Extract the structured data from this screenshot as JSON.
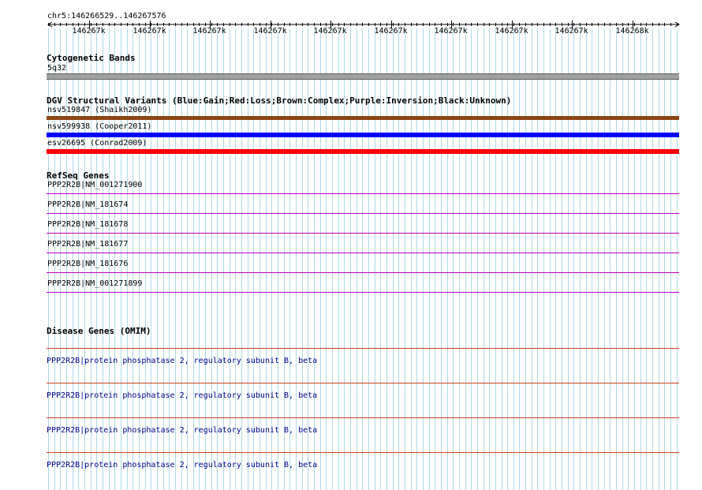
{
  "location": "chr5:146266529..146267576",
  "ruler": {
    "ticks": [
      "146267k",
      "146267k",
      "146267k",
      "146267k",
      "146267k",
      "146267k",
      "146267k",
      "146267k",
      "146267k",
      "146268k"
    ]
  },
  "tracks": {
    "cytoband": {
      "title": "Cytogenetic Bands",
      "label": "5q32",
      "color": "#a0a0a0"
    },
    "dgv": {
      "title": "DGV Structural Variants (Blue:Gain;Red:Loss;Brown:Complex;Purple:Inversion;Black:Unknown)",
      "items": [
        {
          "label": "nsv519847 (Shaikh2009)",
          "color": "#8b4513"
        },
        {
          "label": "nsv599938 (Cooper2011)",
          "color": "#0000ff"
        },
        {
          "label": "esv26695 (Conrad2009)",
          "color": "#ff0000"
        }
      ]
    },
    "refseq": {
      "title": "RefSeq Genes",
      "color": "#c000c0",
      "items": [
        {
          "label": "PPP2R2B|NM_001271900"
        },
        {
          "label": "PPP2R2B|NM_181674"
        },
        {
          "label": "PPP2R2B|NM_181678"
        },
        {
          "label": "PPP2R2B|NM_181677"
        },
        {
          "label": "PPP2R2B|NM_181676"
        },
        {
          "label": "PPP2R2B|NM_001271899"
        }
      ]
    },
    "omim": {
      "title": "Disease Genes (OMIM)",
      "color": "#d04020",
      "text_color": "#00008b",
      "items": [
        {
          "label": "PPP2R2B|protein phosphatase 2, regulatory subunit B, beta"
        },
        {
          "label": "PPP2R2B|protein phosphatase 2, regulatory subunit B, beta"
        },
        {
          "label": "PPP2R2B|protein phosphatase 2, regulatory subunit B, beta"
        },
        {
          "label": "PPP2R2B|protein phosphatase 2, regulatory subunit B, beta"
        }
      ]
    }
  },
  "colors": {
    "grid": "#add8e6",
    "background": "#ffffff"
  }
}
